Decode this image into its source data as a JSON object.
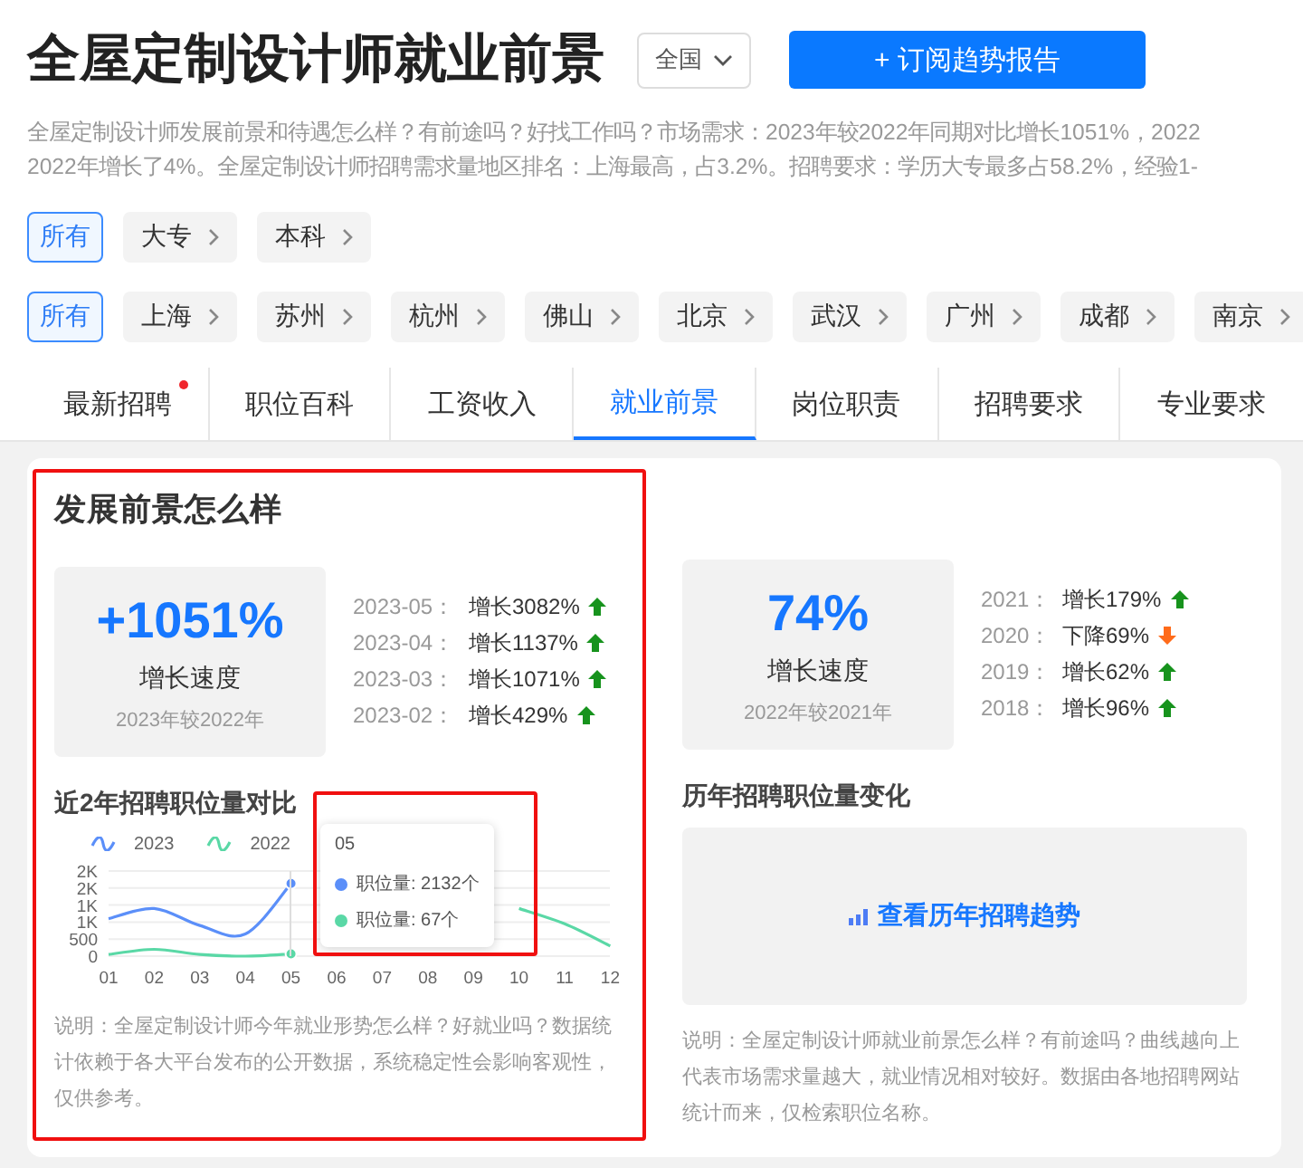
{
  "header": {
    "title": "全屋定制设计师就业前景",
    "region_select": "全国",
    "subscribe_button": "+ 订阅趋势报告"
  },
  "description_lines": [
    "全屋定制设计师发展前景和待遇怎么样？有前途吗？好找工作吗？市场需求：2023年较2022年同期对比增长1051%，2022",
    "2022年增长了4%。全屋定制设计师招聘需求量地区排名：上海最高，占3.2%。招聘要求：学历大专最多占58.2%，经验1-"
  ],
  "filters": [
    {
      "options": [
        {
          "label": "所有",
          "selected": true
        },
        {
          "label": "大专",
          "selected": false
        },
        {
          "label": "本科",
          "selected": false
        }
      ]
    },
    {
      "options": [
        {
          "label": "所有",
          "selected": true
        },
        {
          "label": "上海",
          "selected": false
        },
        {
          "label": "苏州",
          "selected": false
        },
        {
          "label": "杭州",
          "selected": false
        },
        {
          "label": "佛山",
          "selected": false
        },
        {
          "label": "北京",
          "selected": false
        },
        {
          "label": "武汉",
          "selected": false
        },
        {
          "label": "广州",
          "selected": false
        },
        {
          "label": "成都",
          "selected": false
        },
        {
          "label": "南京",
          "selected": false
        }
      ]
    }
  ],
  "tabs": [
    {
      "label": "最新招聘",
      "selected": false,
      "new_dot": true
    },
    {
      "label": "职位百科",
      "selected": false,
      "new_dot": false
    },
    {
      "label": "工资收入",
      "selected": false,
      "new_dot": false
    },
    {
      "label": "就业前景",
      "selected": true,
      "new_dot": false
    },
    {
      "label": "岗位职责",
      "selected": false,
      "new_dot": false
    },
    {
      "label": "招聘要求",
      "selected": false,
      "new_dot": false
    },
    {
      "label": "专业要求",
      "selected": false,
      "new_dot": false
    }
  ],
  "section_title": "发展前景怎么样",
  "panels": [
    {
      "growth": {
        "value": "+1051%",
        "label": "增长速度",
        "compare": "2023年较2022年"
      },
      "history": [
        {
          "period": "2023-05：",
          "change": "增长3082%",
          "kind": "up"
        },
        {
          "period": "2023-04：",
          "change": "增长1137%",
          "kind": "up"
        },
        {
          "period": "2023-03：",
          "change": "增长1071%",
          "kind": "up"
        },
        {
          "period": "2023-02：",
          "change": "增长429%",
          "kind": "up"
        }
      ],
      "subtitle": "近2年招聘职位量对比",
      "chart_data": {
        "type": "line",
        "grid": true,
        "categories": [
          "01",
          "02",
          "03",
          "04",
          "05",
          "06",
          "07",
          "08",
          "09",
          "10",
          "11",
          "12"
        ],
        "ylim": [
          0,
          2500
        ],
        "yticks": [
          {
            "value": 0,
            "label": "0"
          },
          {
            "value": 500,
            "label": "500"
          },
          {
            "value": 1000,
            "label": "1K"
          },
          {
            "value": 1500,
            "label": "1K"
          },
          {
            "value": 2000,
            "label": "2K"
          },
          {
            "value": 2500,
            "label": "2K"
          }
        ],
        "series": [
          {
            "name": "2023",
            "color": "#5b8ff9",
            "values": [
              1100,
              1400,
              900,
              650,
              2132,
              null,
              null,
              null,
              null,
              null,
              null,
              null
            ]
          },
          {
            "name": "2022",
            "color": "#5ad8a6",
            "values": [
              50,
              200,
              50,
              0,
              67,
              null,
              null,
              null,
              null,
              1400,
              950,
              300
            ]
          }
        ]
      },
      "tooltip": {
        "title": "05",
        "rows": [
          {
            "text": "职位量: 2132个",
            "color": "#5b8ff9"
          },
          {
            "text": "职位量: 67个",
            "color": "#5ad8a6"
          }
        ]
      },
      "note": "说明：全屋定制设计师今年就业形势怎么样？好就业吗？数据统计依赖于各大平台发布的公开数据，系统稳定性会影响客观性，仅供参考。"
    },
    {
      "growth": {
        "value": "74%",
        "label": "增长速度",
        "compare": "2022年较2021年"
      },
      "history": [
        {
          "period": "2021：",
          "change": "增长179%",
          "kind": "up"
        },
        {
          "period": "2020：",
          "change": "下降69%",
          "kind": "down"
        },
        {
          "period": "2019：",
          "change": "增长62%",
          "kind": "up"
        },
        {
          "period": "2018：",
          "change": "增长96%",
          "kind": "up"
        }
      ],
      "subtitle": "历年招聘职位量变化",
      "trend_link": "查看历年招聘趋势",
      "note": "说明：全屋定制设计师就业前景怎么样？有前途吗？曲线越向上代表市场需求量越大，就业情况相对较好。数据由各地招聘网站统计而来，仅检索职位名称。"
    }
  ]
}
